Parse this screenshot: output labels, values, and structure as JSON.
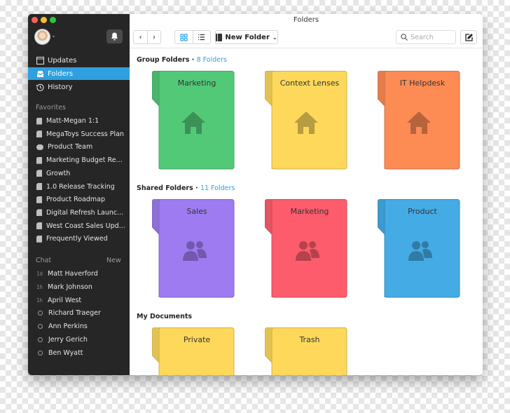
{
  "window": {
    "title": "Folders"
  },
  "colors": {
    "accent": "#2f9fe0",
    "green": "#52c977",
    "yellow": "#fdd85b",
    "orange": "#fd8b54",
    "purple": "#9e7bf0",
    "red": "#fc5c6b",
    "blue": "#44abe5"
  },
  "sidebar": {
    "nav": [
      {
        "label": "Updates",
        "icon": "calendar-icon"
      },
      {
        "label": "Folders",
        "icon": "inbox-icon",
        "active": true
      },
      {
        "label": "History",
        "icon": "history-icon"
      }
    ],
    "favorites_title": "Favorites",
    "favorites": [
      "Matt-Megan 1:1",
      "MegaToys Success Plan",
      "Product Team",
      "Marketing Budget Re...",
      "Growth",
      "1.0 Release Tracking",
      "Product Roadmap",
      "Digital Refresh Launc...",
      "West Coast Sales Upd...",
      "Frequently Viewed"
    ],
    "chat_title": "Chat",
    "chat_new": "New",
    "chat": [
      {
        "tag": "1d",
        "name": "Matt Haverford"
      },
      {
        "tag": "1h",
        "name": "Mark Johnson"
      },
      {
        "tag": "1h",
        "name": "April West"
      },
      {
        "tag": "",
        "name": "Richard Traeger"
      },
      {
        "tag": "",
        "name": "Ann Perkins"
      },
      {
        "tag": "",
        "name": "Jerry Gerich"
      },
      {
        "tag": "",
        "name": "Ben Wyatt"
      }
    ]
  },
  "toolbar": {
    "new_folder": "New Folder",
    "search_placeholder": "Search"
  },
  "sections": [
    {
      "title": "Group Folders",
      "count": "8 Folders",
      "folders": [
        {
          "name": "Marketing",
          "color": "#52c977",
          "icon": "home-icon"
        },
        {
          "name": "Context Lenses",
          "color": "#fdd85b",
          "icon": "home-icon"
        },
        {
          "name": "IT Helpdesk",
          "color": "#fd8b54",
          "icon": "home-icon"
        }
      ]
    },
    {
      "title": "Shared Folders",
      "count": "11 Folders",
      "folders": [
        {
          "name": "Sales",
          "color": "#9e7bf0",
          "icon": "people-icon"
        },
        {
          "name": "Marketing",
          "color": "#fc5c6b",
          "icon": "people-icon"
        },
        {
          "name": "Product",
          "color": "#44abe5",
          "icon": "people-icon"
        }
      ]
    },
    {
      "title": "My Documents",
      "count": "",
      "folders": [
        {
          "name": "Private",
          "color": "#fdd85b",
          "icon": "lock-icon"
        },
        {
          "name": "Trash",
          "color": "#fdd85b",
          "icon": "trash-icon"
        }
      ]
    }
  ]
}
